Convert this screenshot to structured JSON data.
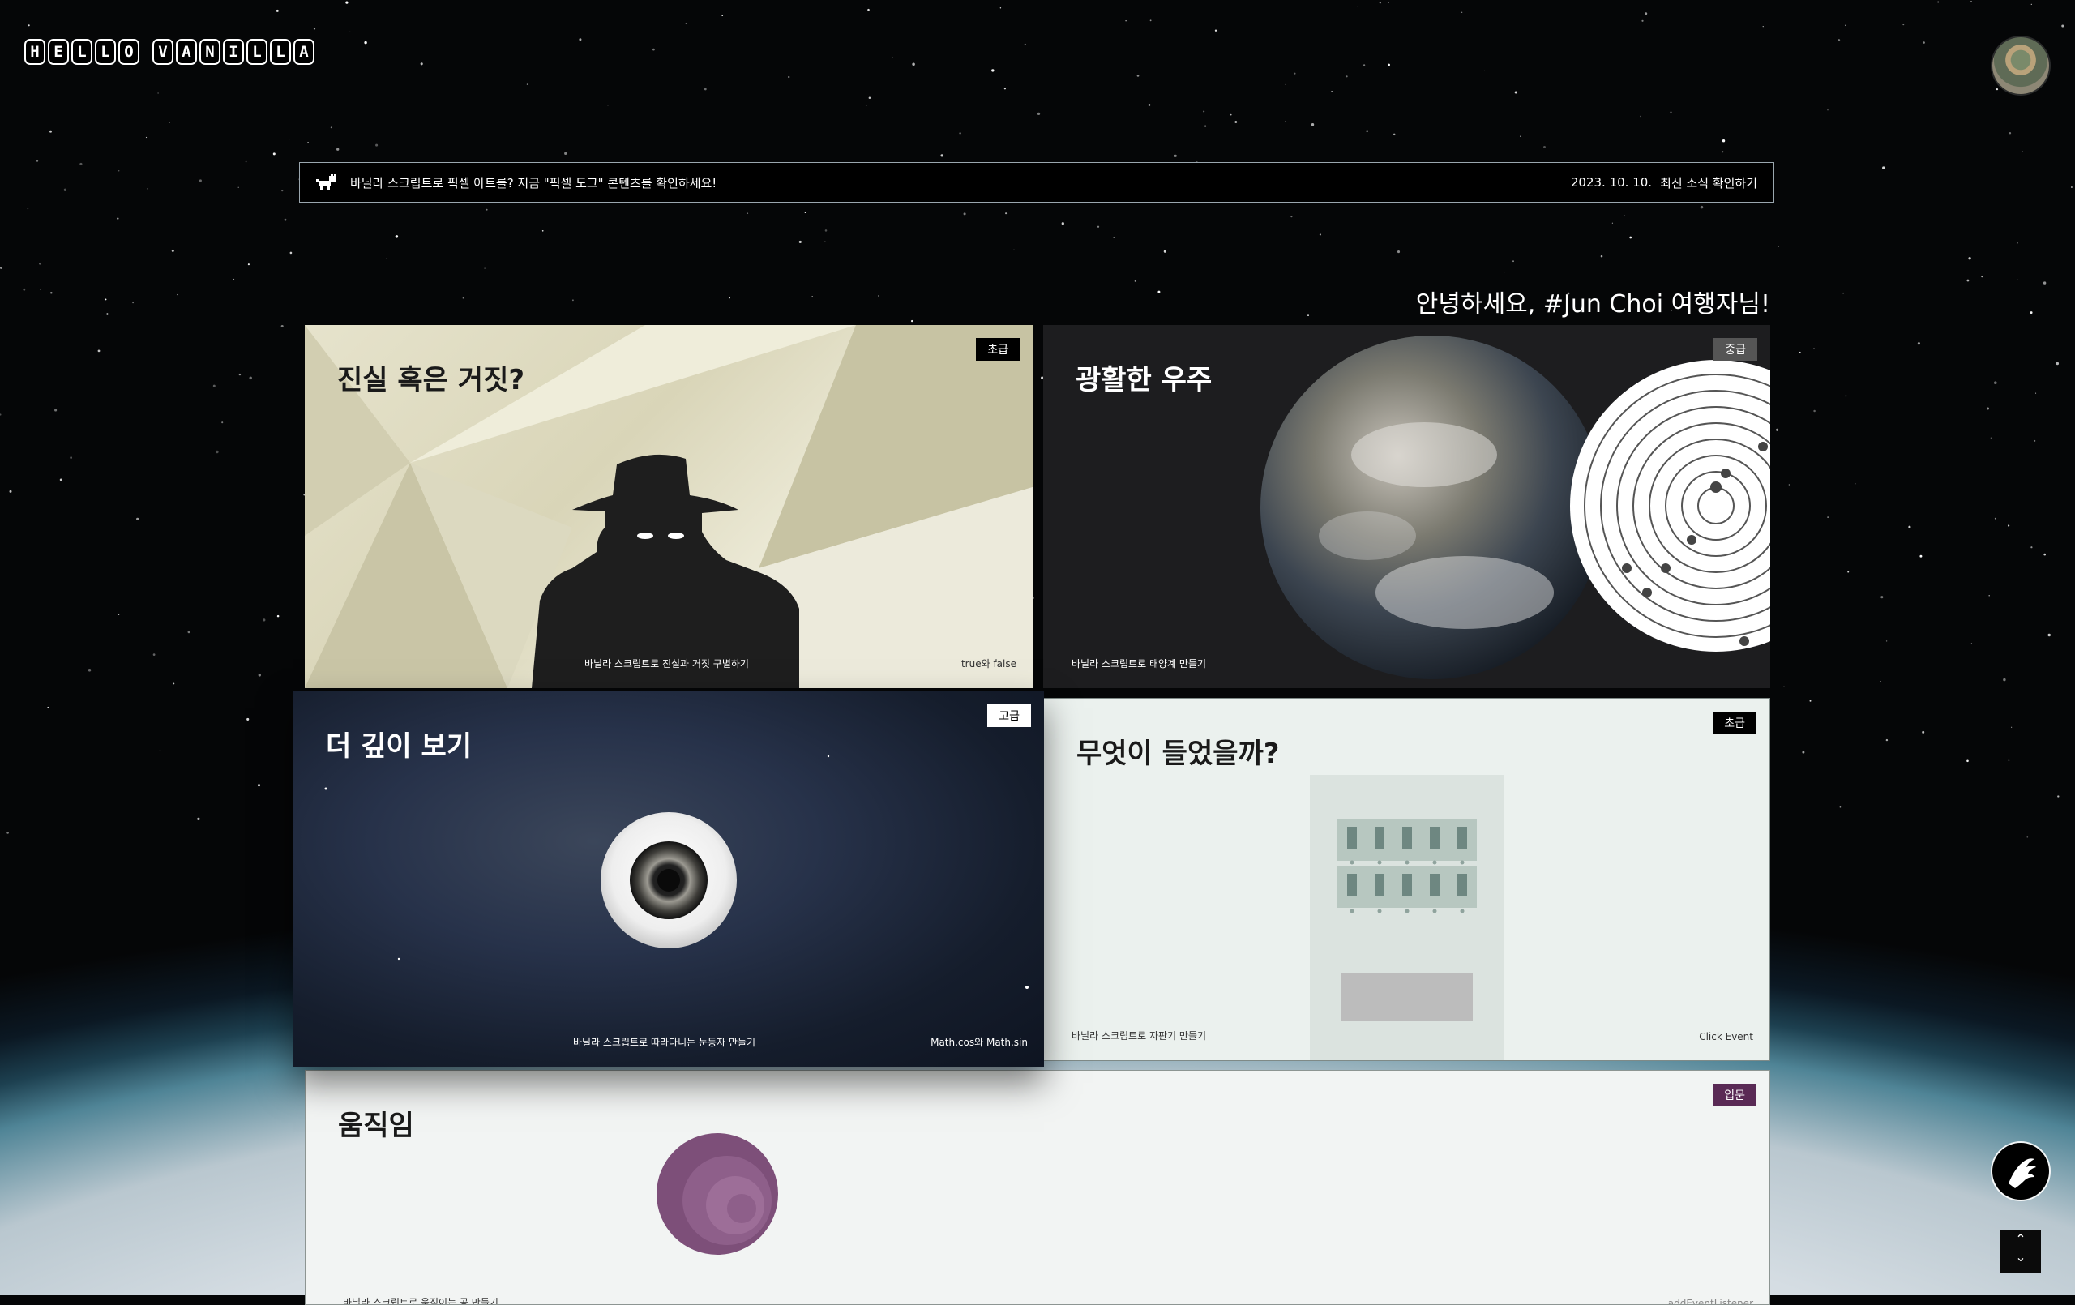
{
  "header": {
    "logo_letters": [
      "H",
      "E",
      "L",
      "L",
      "O",
      " ",
      "V",
      "A",
      "N",
      "I",
      "L",
      "L",
      "A"
    ]
  },
  "notice": {
    "icon": "dog-icon",
    "message": "바닐라 스크립트로 픽셀 아트를? 지금 \"픽셀 도그\" 콘텐츠를 확인하세요!",
    "date": "2023. 10. 10.",
    "link": "최신 소식 확인하기"
  },
  "greeting": "안녕하세요, #Jun Choi 여행자님!",
  "cards": [
    {
      "title": "진실 혹은 거짓?",
      "badge": "초급",
      "desc": "바닐라 스크립트로 진실과 거짓 구별하기",
      "tag": "true와 false"
    },
    {
      "title": "광활한 우주",
      "badge": "중급",
      "desc": "바닐라 스크립트로 태양계 만들기",
      "tag": ""
    },
    {
      "title": "더 깊이 보기",
      "badge": "고급",
      "desc": "바닐라 스크립트로 따라다니는 눈동자 만들기",
      "tag": "Math.cos와 Math.sin"
    },
    {
      "title": "무엇이 들었을까?",
      "badge": "초급",
      "desc": "바닐라 스크립트로 자판기 만들기",
      "tag": "Click Event"
    },
    {
      "title": "움직임",
      "badge": "입문",
      "desc": "바닐라 스크립트로 움직이는 공 만들기",
      "tag": "addEventListener"
    }
  ],
  "colors": {
    "badge_default": "#000000",
    "badge_intermediate": "#555555",
    "badge_advanced": "#ffffff",
    "badge_intro": "#5a2a55"
  },
  "scroll": {
    "up": "⌃",
    "down": "⌄"
  }
}
